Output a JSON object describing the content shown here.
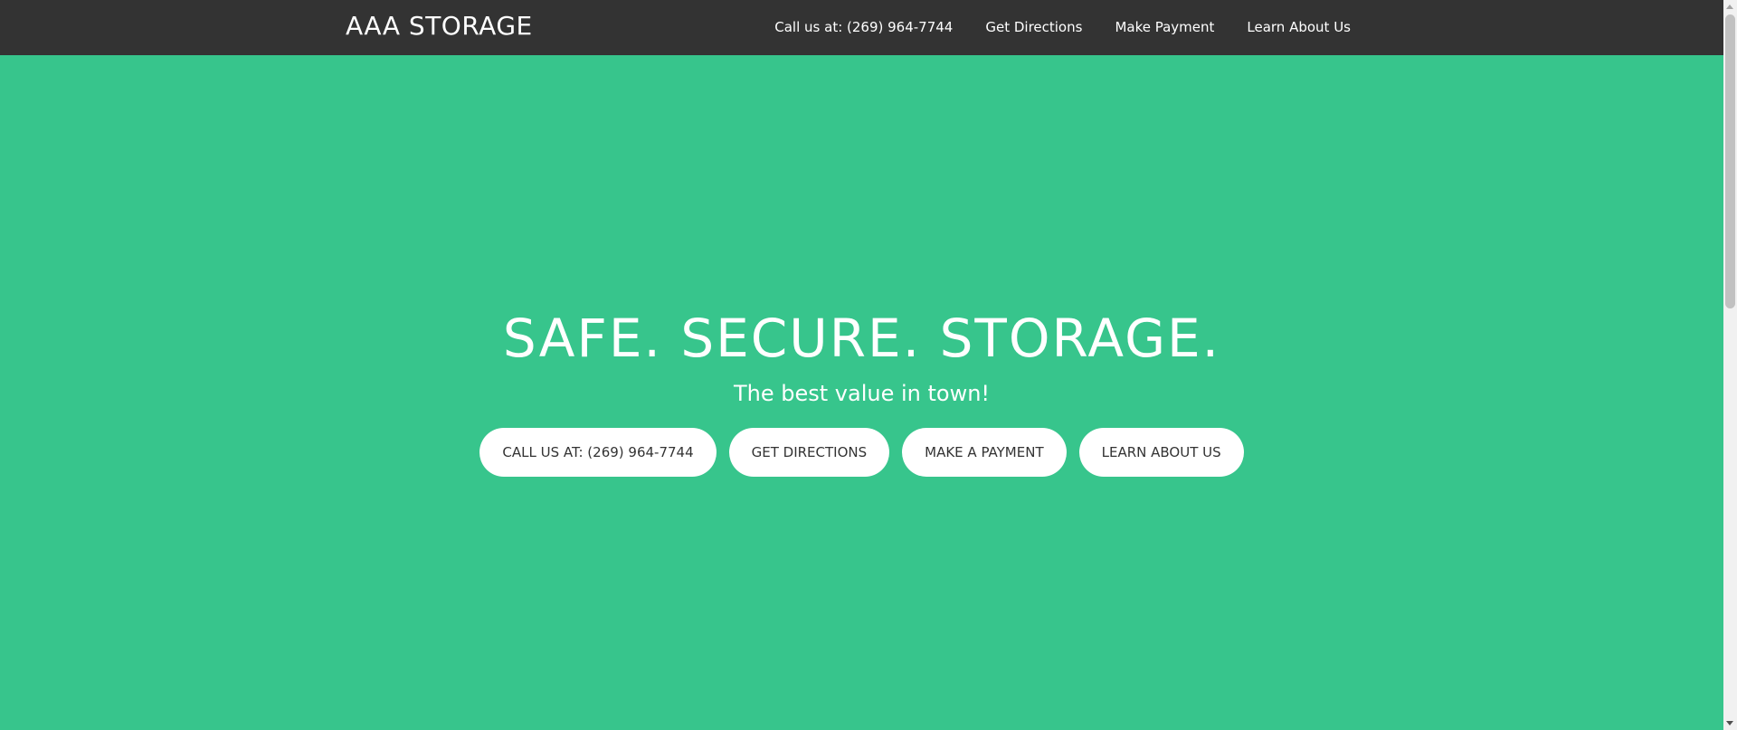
{
  "navbar": {
    "brand": "AAA STORAGE",
    "links": [
      {
        "label": "Call us at: (269) 964-7744"
      },
      {
        "label": "Get Directions"
      },
      {
        "label": "Make Payment"
      },
      {
        "label": "Learn About Us"
      }
    ]
  },
  "hero": {
    "title": "SAFE. SECURE. STORAGE.",
    "subtitle": "The best value in town!",
    "buttons": [
      {
        "label": "CALL US AT: (269) 964-7744"
      },
      {
        "label": "GET DIRECTIONS"
      },
      {
        "label": "MAKE A PAYMENT"
      },
      {
        "label": "LEARN ABOUT US"
      }
    ]
  },
  "colors": {
    "navbar_bg": "#333333",
    "hero_bg": "#37c58c",
    "button_bg": "#ffffff",
    "button_text": "#333333"
  }
}
